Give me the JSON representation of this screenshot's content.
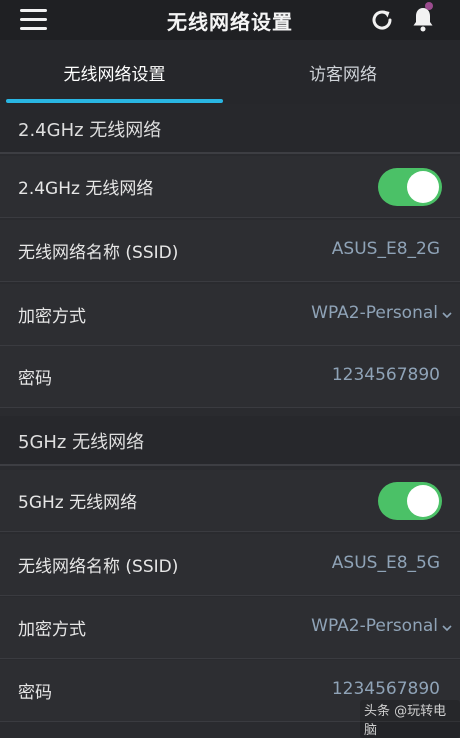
{
  "header": {
    "title": "无线网络设置",
    "menu_icon": "menu-icon",
    "refresh_icon": "refresh-icon",
    "bell_icon": "bell-icon"
  },
  "tabs": [
    {
      "label": "无线网络设置",
      "active": true
    },
    {
      "label": "访客网络",
      "active": false
    }
  ],
  "bands": [
    {
      "section_title": "2.4GHz 无线网络",
      "toggle_label": "2.4GHz 无线网络",
      "enabled": true,
      "ssid_label": "无线网络名称 (SSID)",
      "ssid": "ASUS_E8_2G",
      "encryption_label": "加密方式",
      "encryption": "WPA2-Personal",
      "password_label": "密码",
      "password": "1234567890"
    },
    {
      "section_title": "5GHz 无线网络",
      "toggle_label": "5GHz 无线网络",
      "enabled": true,
      "ssid_label": "无线网络名称 (SSID)",
      "ssid": "ASUS_E8_5G",
      "encryption_label": "加密方式",
      "encryption": "WPA2-Personal",
      "password_label": "密码",
      "password": "1234567890"
    }
  ],
  "watermark": "头条 @玩转电脑",
  "colors": {
    "accent": "#29b6e3",
    "toggle_on": "#4bc167",
    "value_text": "#8fa3b7",
    "background": "#2a2b2f"
  }
}
